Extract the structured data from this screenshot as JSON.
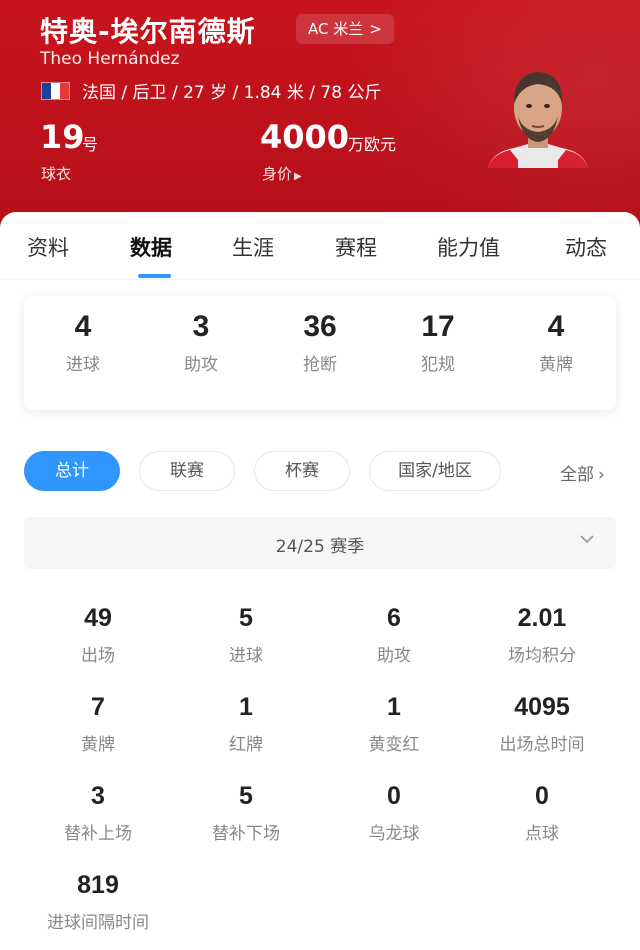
{
  "header": {
    "name_cn": "特奥-埃尔南德斯",
    "club": "AC 米兰",
    "club_arrow": ">",
    "name_en": "Theo Hernández",
    "meta": "法国 / 后卫 / 27 岁 / 1.84 米 / 78 公斤",
    "flag_colors": [
      "#1d3f9e",
      "#ffffff",
      "#e53935"
    ],
    "shirt_number": "19",
    "shirt_unit": "号",
    "shirt_label": "球衣",
    "market_value": "4000",
    "market_unit": "万欧元",
    "market_label": "身价"
  },
  "tabs": [
    {
      "label": "资料"
    },
    {
      "label": "数据"
    },
    {
      "label": "生涯"
    },
    {
      "label": "赛程"
    },
    {
      "label": "能力值"
    },
    {
      "label": "动态"
    }
  ],
  "summary": [
    {
      "value": "4",
      "label": "进球"
    },
    {
      "value": "3",
      "label": "助攻"
    },
    {
      "value": "36",
      "label": "抢断"
    },
    {
      "value": "17",
      "label": "犯规"
    },
    {
      "value": "4",
      "label": "黄牌"
    }
  ],
  "filters": [
    {
      "label": "总计"
    },
    {
      "label": "联赛"
    },
    {
      "label": "杯赛"
    },
    {
      "label": "国家/地区"
    }
  ],
  "filter_all": "全部",
  "season": "24/25 赛季",
  "stats": [
    {
      "value": "49",
      "label": "出场"
    },
    {
      "value": "5",
      "label": "进球"
    },
    {
      "value": "6",
      "label": "助攻"
    },
    {
      "value": "2.01",
      "label": "场均积分"
    },
    {
      "value": "7",
      "label": "黄牌"
    },
    {
      "value": "1",
      "label": "红牌"
    },
    {
      "value": "1",
      "label": "黄变红"
    },
    {
      "value": "4095",
      "label": "出场总时间"
    },
    {
      "value": "3",
      "label": "替补上场"
    },
    {
      "value": "5",
      "label": "替补下场"
    },
    {
      "value": "0",
      "label": "乌龙球"
    },
    {
      "value": "0",
      "label": "点球"
    },
    {
      "value": "819",
      "label": "进球间隔时间"
    }
  ],
  "colors": {
    "header_red": "#c8141c",
    "accent_blue": "#2f95ff"
  }
}
